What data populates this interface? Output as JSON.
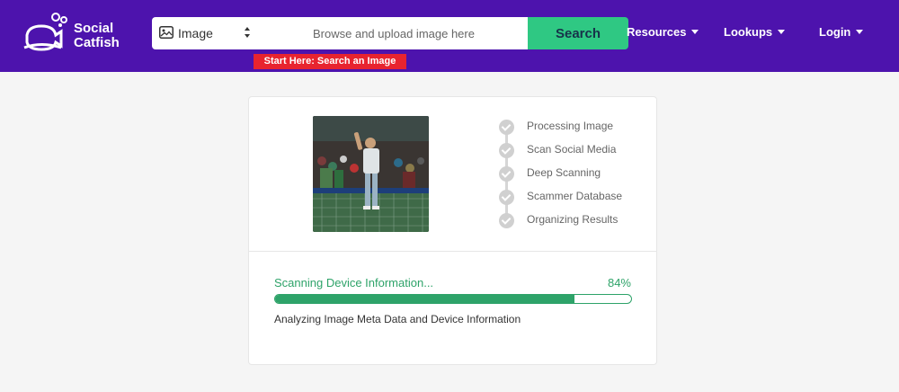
{
  "brand": {
    "line1": "Social",
    "line2": "Catfish"
  },
  "colors": {
    "header_bg": "#4d13ad",
    "search_button": "#2fc883",
    "start_banner": "#e8242f",
    "progress": "#2ea369"
  },
  "search": {
    "type_label": "Image",
    "placeholder": "Browse and upload image here",
    "button_label": "Search",
    "start_banner": "Start Here: Search an Image"
  },
  "nav": {
    "resources": "Resources",
    "lookups": "Lookups",
    "login": "Login"
  },
  "steps": [
    {
      "label": "Processing Image"
    },
    {
      "label": "Scan Social Media"
    },
    {
      "label": "Deep Scanning"
    },
    {
      "label": "Scammer Database"
    },
    {
      "label": "Organizing Results"
    }
  ],
  "scan": {
    "title": "Scanning Device Information...",
    "percent_label": "84%",
    "percent": 84,
    "description": "Analyzing Image Meta Data and Device Information"
  }
}
